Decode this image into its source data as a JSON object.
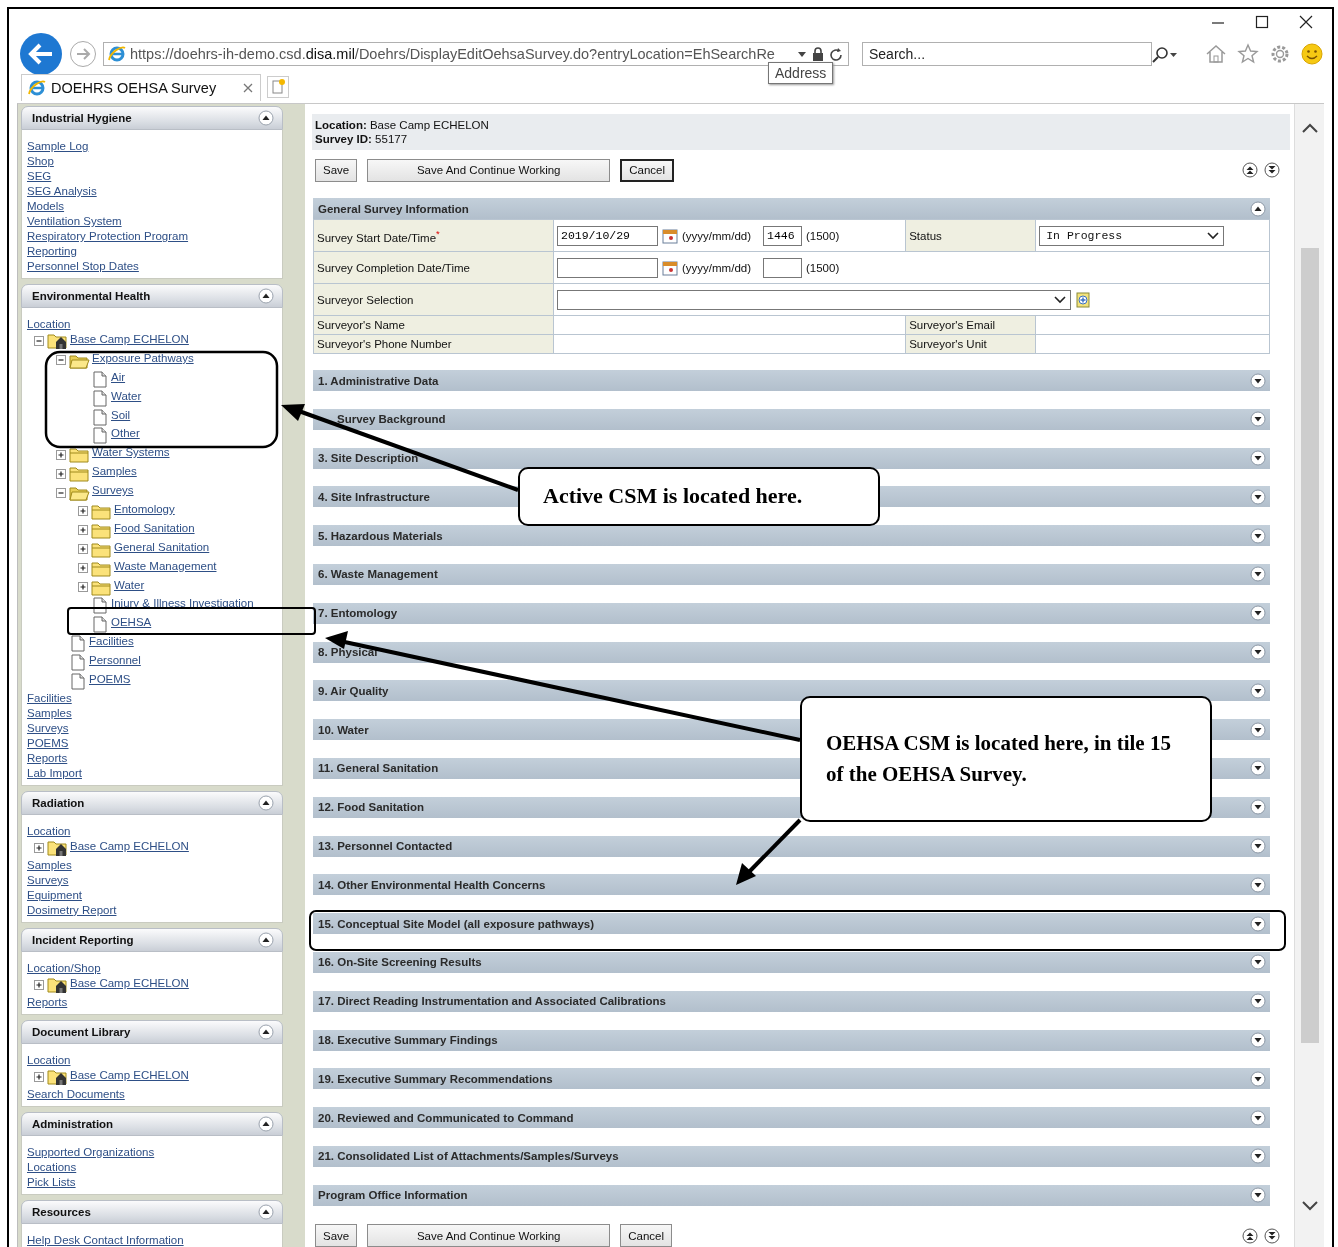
{
  "browser": {
    "url": "https://doehrs-ih-demo.csd.**disa.mil**/Doehrs/DisplayEditOehsaSurvey.do?entryLocation=EhSearchRe",
    "tooltip": "Address",
    "search_placeholder": "Search...",
    "tab_title": "DOEHRS OEHSA Survey"
  },
  "sidebar": {
    "panels": [
      {
        "title": "Industrial Hygiene",
        "expanded": true,
        "items": [
          {
            "kind": "link",
            "label": "Sample Log"
          },
          {
            "kind": "link",
            "label": "Shop"
          },
          {
            "kind": "link",
            "label": "SEG"
          },
          {
            "kind": "link",
            "label": "SEG Analysis"
          },
          {
            "kind": "link",
            "label": "Models"
          },
          {
            "kind": "link",
            "label": "Ventilation System"
          },
          {
            "kind": "link",
            "label": "Respiratory Protection Program"
          },
          {
            "kind": "link",
            "label": "Reporting"
          },
          {
            "kind": "link",
            "label": "Personnel Stop Dates"
          }
        ]
      },
      {
        "title": "Environmental Health",
        "expanded": true,
        "items": [
          {
            "kind": "link",
            "label": "Location"
          },
          {
            "kind": "site",
            "label": "Base Camp ECHELON",
            "expanded": true,
            "children": [
              {
                "kind": "folder",
                "label": "Exposure Pathways",
                "expanded": true,
                "children": [
                  {
                    "kind": "page",
                    "label": "Air"
                  },
                  {
                    "kind": "page",
                    "label": "Water"
                  },
                  {
                    "kind": "page",
                    "label": "Soil"
                  },
                  {
                    "kind": "page",
                    "label": "Other"
                  }
                ]
              },
              {
                "kind": "folder",
                "label": "Water Systems",
                "expanded": false
              },
              {
                "kind": "folder",
                "label": "Samples",
                "expanded": false
              },
              {
                "kind": "folder",
                "label": "Surveys",
                "expanded": true,
                "children": [
                  {
                    "kind": "folder",
                    "label": "Entomology",
                    "expanded": false
                  },
                  {
                    "kind": "folder",
                    "label": "Food Sanitation",
                    "expanded": false
                  },
                  {
                    "kind": "folder",
                    "label": "General Sanitation",
                    "expanded": false
                  },
                  {
                    "kind": "folder",
                    "label": "Waste Management",
                    "expanded": false
                  },
                  {
                    "kind": "folder",
                    "label": "Water",
                    "expanded": false
                  },
                  {
                    "kind": "page",
                    "label": "Injury & Illness Investigation"
                  },
                  {
                    "kind": "page",
                    "label": "OEHSA"
                  }
                ]
              },
              {
                "kind": "page",
                "label": "Facilities"
              },
              {
                "kind": "page",
                "label": "Personnel"
              },
              {
                "kind": "page",
                "label": "POEMS"
              }
            ]
          },
          {
            "kind": "link",
            "label": "Facilities"
          },
          {
            "kind": "link",
            "label": "Samples"
          },
          {
            "kind": "link",
            "label": "Surveys"
          },
          {
            "kind": "link",
            "label": "POEMS"
          },
          {
            "kind": "link",
            "label": "Reports"
          },
          {
            "kind": "link",
            "label": "Lab Import"
          }
        ]
      },
      {
        "title": "Radiation",
        "expanded": true,
        "items": [
          {
            "kind": "link",
            "label": "Location"
          },
          {
            "kind": "site",
            "label": "Base Camp ECHELON",
            "expanded": false
          },
          {
            "kind": "link",
            "label": "Samples"
          },
          {
            "kind": "link",
            "label": "Surveys"
          },
          {
            "kind": "link",
            "label": "Equipment"
          },
          {
            "kind": "link",
            "label": "Dosimetry Report"
          }
        ]
      },
      {
        "title": "Incident Reporting",
        "expanded": true,
        "items": [
          {
            "kind": "link",
            "label": "Location/Shop"
          },
          {
            "kind": "site",
            "label": "Base Camp ECHELON",
            "expanded": false
          },
          {
            "kind": "link",
            "label": "Reports"
          }
        ]
      },
      {
        "title": "Document Library",
        "expanded": true,
        "items": [
          {
            "kind": "link",
            "label": "Location"
          },
          {
            "kind": "site",
            "label": "Base Camp ECHELON",
            "expanded": false
          },
          {
            "kind": "link",
            "label": "Search Documents"
          }
        ]
      },
      {
        "title": "Administration",
        "expanded": true,
        "items": [
          {
            "kind": "link",
            "label": "Supported Organizations"
          },
          {
            "kind": "link",
            "label": "Locations"
          },
          {
            "kind": "link",
            "label": "Pick Lists"
          }
        ]
      },
      {
        "title": "Resources",
        "expanded": true,
        "items": [
          {
            "kind": "link",
            "label": "Help Desk Contact Information"
          }
        ]
      }
    ]
  },
  "header": {
    "location_label": "Location:",
    "location": "Base Camp ECHELON",
    "survey_id_label": "Survey ID:",
    "survey_id": "55177"
  },
  "buttons_top": [
    {
      "label": "Save",
      "focused": false
    },
    {
      "label": "Save And Continue Working",
      "focused": false
    },
    {
      "label": "Cancel",
      "focused": true
    }
  ],
  "general": {
    "title": "General Survey Information",
    "expanded": true,
    "start": {
      "label": "Survey Start Date/Time",
      "required_mark": "*",
      "date": "2019/10/29",
      "date_hint": "(yyyy/mm/dd)",
      "time": "1446",
      "time_hint": "(1500)"
    },
    "status": {
      "label": "Status",
      "value": "In Progress"
    },
    "completion": {
      "label": "Survey Completion Date/Time",
      "date_hint": "(yyyy/mm/dd)",
      "time_hint": "(1500)"
    },
    "surveyor_selection": {
      "label": "Surveyor Selection"
    },
    "name_label": "Surveyor's Name",
    "email_label": "Surveyor's Email",
    "phone_label": "Surveyor's Phone Number",
    "unit_label": "Surveyor's Unit"
  },
  "sections": [
    {
      "title": "1. Administrative Data",
      "expanded": false
    },
    {
      "title": "Survey Background",
      "expanded": false
    },
    {
      "title": "3. Site Description",
      "expanded": false
    },
    {
      "title": "4. Site Infrastructure",
      "expanded": false
    },
    {
      "title": "5. Hazardous Materials",
      "expanded": false
    },
    {
      "title": "6. Waste Management",
      "expanded": false
    },
    {
      "title": "7. Entomology",
      "expanded": false
    },
    {
      "title": "8. Physical",
      "expanded": false
    },
    {
      "title": "9. Air Quality",
      "expanded": false
    },
    {
      "title": "10. Water",
      "expanded": false
    },
    {
      "title": "11. General Sanitation",
      "expanded": false
    },
    {
      "title": "12. Food Sanitation",
      "expanded": false
    },
    {
      "title": "13. Personnel Contacted",
      "expanded": false
    },
    {
      "title": "14. Other Environmental Health Concerns",
      "expanded": false
    },
    {
      "title": "15. Conceptual Site Model (all exposure pathways)",
      "expanded": false
    },
    {
      "title": "16. On-Site Screening Results",
      "expanded": false
    },
    {
      "title": "17. Direct Reading Instrumentation and Associated Calibrations",
      "expanded": false
    },
    {
      "title": "18. Executive Summary Findings",
      "expanded": false
    },
    {
      "title": "19. Executive Summary Recommendations",
      "expanded": false
    },
    {
      "title": "20. Reviewed and Communicated to Command",
      "expanded": false
    },
    {
      "title": "21. Consolidated List of Attachments/Samples/Surveys",
      "expanded": false
    },
    {
      "title": "Program Office Information",
      "expanded": false
    }
  ],
  "buttons_bottom": [
    {
      "label": "Save",
      "focused": false
    },
    {
      "label": "Save And Continue Working",
      "focused": false
    },
    {
      "label": "Cancel",
      "focused": false
    }
  ],
  "annotations": [
    {
      "text": "Active CSM is located here."
    },
    {
      "text": "OEHSA CSM is located here, in tile 15 of the OEHSA Survey."
    }
  ]
}
